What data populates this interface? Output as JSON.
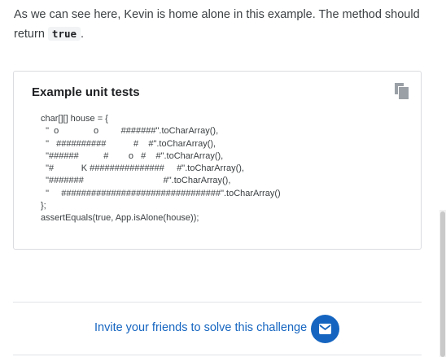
{
  "intro": {
    "text_before": "As we can see here, Kevin is home alone in this example. The method should return ",
    "inline_code": "true",
    "text_after": "."
  },
  "example_card": {
    "title": "Example unit tests",
    "copy_icon": "copy-icon",
    "code_lines": [
      "char[][] house = {",
      "  \"  o              o         #######\".toCharArray(),",
      "  \"   ##########           #    #\".toCharArray(),",
      "  \"######          #        o   #    #\".toCharArray(),",
      "  \"#           K ###############     #\".toCharArray(),",
      "  \"#######                                #\".toCharArray(),",
      "  \"     ################################\".toCharArray()",
      "};",
      "assertEquals(true, App.isAlone(house));"
    ]
  },
  "invite": {
    "label": "Invite your friends to solve this challenge",
    "icon": "mail-icon",
    "accent_color": "#1565c0"
  }
}
